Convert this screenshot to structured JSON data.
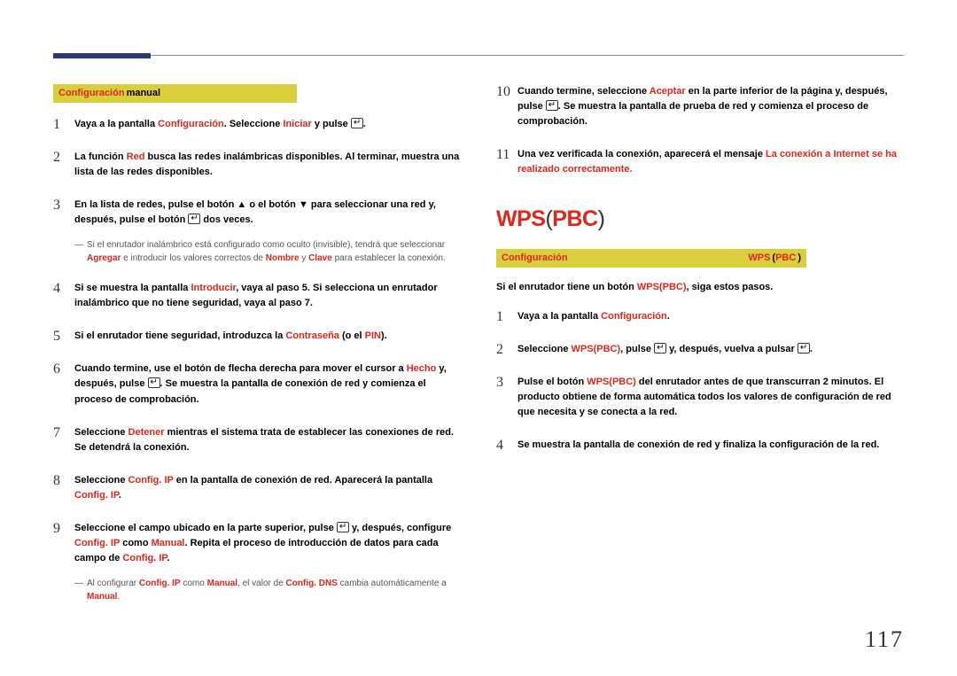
{
  "page_number": "117",
  "left": {
    "yellow_label_red": "Configuración",
    "yellow_label_rest": "manual",
    "steps": [
      {
        "n": "1",
        "parts": [
          {
            "t": "Vaya a la pantalla "
          },
          {
            "t": "Configuración",
            "red": true
          },
          {
            "t": ". Seleccione "
          },
          {
            "t": "Iniciar",
            "red": true
          },
          {
            "t": " y pulse "
          },
          {
            "icon": "enter"
          },
          {
            "t": "."
          }
        ]
      },
      {
        "n": "2",
        "parts": [
          {
            "t": "La función "
          },
          {
            "t": "Red",
            "red": true
          },
          {
            "t": " busca las redes inalámbricas disponibles. Al terminar, muestra una lista de las redes disponibles."
          }
        ]
      },
      {
        "n": "3",
        "parts": [
          {
            "t": "En la lista de redes, pulse el botón "
          },
          {
            "t": "▲",
            "cls": "arrow-up"
          },
          {
            "t": " o el botón "
          },
          {
            "t": "▼",
            "cls": "arrow-down"
          },
          {
            "t": " para seleccionar una red y, después, pulse el botón "
          },
          {
            "icon": "enter"
          },
          {
            "t": " dos veces."
          }
        ]
      },
      {
        "n": "4",
        "parts": [
          {
            "t": "Si se muestra la pantalla "
          },
          {
            "t": "Introducir",
            "red": true
          },
          {
            "t": ", vaya al paso 5. Si selecciona un enrutador inalámbrico que no tiene seguridad, vaya al paso 7."
          }
        ]
      },
      {
        "n": "5",
        "parts": [
          {
            "t": "Si el enrutador tiene seguridad, introduzca la "
          },
          {
            "t": "Contraseña",
            "red": true
          },
          {
            "t": " (o el "
          },
          {
            "t": "PIN",
            "red": true
          },
          {
            "t": ")."
          }
        ]
      },
      {
        "n": "6",
        "parts": [
          {
            "t": "Cuando termine, use el botón de flecha derecha para mover el cursor a "
          },
          {
            "t": "Hecho",
            "red": true
          },
          {
            "t": " y, después, pulse "
          },
          {
            "icon": "enter"
          },
          {
            "t": ". Se muestra la pantalla de conexión de red y comienza el proceso de comprobación."
          }
        ]
      },
      {
        "n": "7",
        "parts": [
          {
            "t": "Seleccione "
          },
          {
            "t": "Detener",
            "red": true
          },
          {
            "t": " mientras el sistema trata de establecer las conexiones de red. Se detendrá la conexión."
          }
        ]
      },
      {
        "n": "8",
        "parts": [
          {
            "t": "Seleccione "
          },
          {
            "t": "Config. IP",
            "red": true
          },
          {
            "t": " en la pantalla de conexión de red. Aparecerá la pantalla "
          },
          {
            "t": "Config. IP",
            "red": true
          },
          {
            "t": "."
          }
        ]
      },
      {
        "n": "9",
        "parts": [
          {
            "t": "Seleccione el campo ubicado en la parte superior, pulse "
          },
          {
            "icon": "enter"
          },
          {
            "t": " y, después, configure "
          },
          {
            "t": "Config. IP",
            "red": true
          },
          {
            "t": " como "
          },
          {
            "t": "Manual",
            "red": true
          },
          {
            "t": ". Repita el proceso de introducción de datos para cada campo de "
          },
          {
            "t": "Config. IP",
            "red": true
          },
          {
            "t": "."
          }
        ]
      }
    ],
    "note1": {
      "dash": "―",
      "parts": [
        {
          "t": "Si el enrutador inalámbrico está configurado como oculto (invisible), tendrá que seleccionar "
        },
        {
          "t": "Agregar",
          "red": true
        },
        {
          "t": " e introducir los valores correctos de "
        },
        {
          "t": "Nombre",
          "red": true
        },
        {
          "t": " y "
        },
        {
          "t": "Clave",
          "red": true
        },
        {
          "t": " para establecer la conexión."
        }
      ]
    },
    "note2": {
      "dash": "―",
      "parts": [
        {
          "t": "Al configurar "
        },
        {
          "t": "Config. IP",
          "red": true
        },
        {
          "t": " como "
        },
        {
          "t": "Manual",
          "red": true
        },
        {
          "t": ", el valor de "
        },
        {
          "t": "Config. DNS",
          "red": true
        },
        {
          "t": " cambia automáticamente a "
        },
        {
          "t": "Manual",
          "red": true
        },
        {
          "t": "."
        }
      ]
    }
  },
  "right": {
    "top_steps": [
      {
        "n": "10",
        "parts": [
          {
            "t": "Cuando termine, seleccione "
          },
          {
            "t": "Aceptar",
            "red": true
          },
          {
            "t": " en la parte inferior de la página y, después, pulse "
          },
          {
            "icon": "enter"
          },
          {
            "t": ". Se muestra la pantalla de prueba de red y comienza el proceso de comprobación."
          }
        ]
      },
      {
        "n": "11",
        "parts": [
          {
            "t": "Una vez verificada la conexión, aparecerá el mensaje "
          },
          {
            "t": "La conexión a Internet se ha realizado correctamente.",
            "red": true
          }
        ]
      }
    ],
    "heading_parts": [
      {
        "t": "WPS",
        "red": true
      },
      {
        "t": "("
      },
      {
        "t": "PBC",
        "red": true
      },
      {
        "t": ")"
      }
    ],
    "yellow2_red": "Configuración",
    "yellow2_rest": "",
    "yellow2_paren_parts": [
      {
        "t": "WPS",
        "red": true
      },
      {
        "t": "("
      },
      {
        "t": "PBC",
        "red": true
      },
      {
        "t": ")"
      }
    ],
    "subintro_parts": [
      {
        "t": "Si el enrutador tiene un botón "
      },
      {
        "t": "WPS(PBC)",
        "red": true
      },
      {
        "t": ", siga estos pasos."
      }
    ],
    "steps": [
      {
        "n": "1",
        "parts": [
          {
            "t": "Vaya a la pantalla "
          },
          {
            "t": "Configuración",
            "red": true
          },
          {
            "t": "."
          }
        ]
      },
      {
        "n": "2",
        "parts": [
          {
            "t": "Seleccione "
          },
          {
            "t": "WPS(PBC)",
            "red": true
          },
          {
            "t": ", pulse "
          },
          {
            "icon": "enter"
          },
          {
            "t": " y, después, vuelva a pulsar "
          },
          {
            "icon": "enter"
          },
          {
            "t": "."
          }
        ]
      },
      {
        "n": "3",
        "parts": [
          {
            "t": "Pulse el botón "
          },
          {
            "t": "WPS(PBC)",
            "red": true
          },
          {
            "t": " del enrutador antes de que transcurran 2 minutos. El producto obtiene de forma automática todos los valores de configuración de red que necesita y se conecta a la red."
          }
        ]
      },
      {
        "n": "4",
        "parts": [
          {
            "t": "Se muestra la pantalla de conexión de red y finaliza la configuración de la red."
          }
        ]
      }
    ]
  }
}
